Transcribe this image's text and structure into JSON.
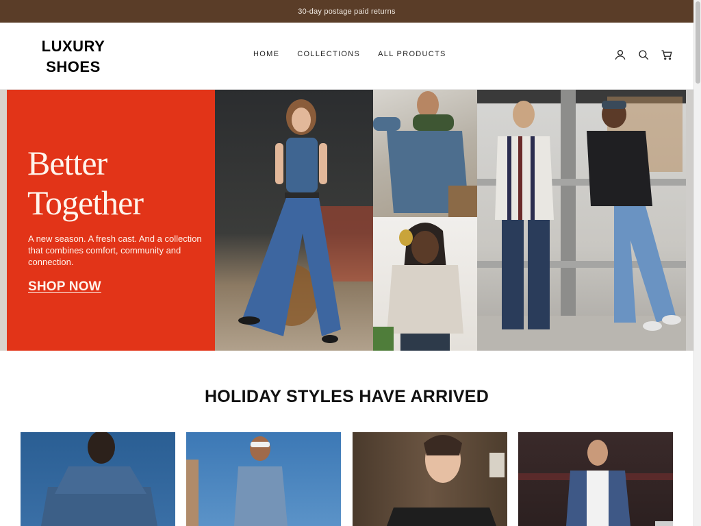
{
  "announcement": {
    "text": "30-day postage paid returns"
  },
  "header": {
    "logo_line1": "LUXURY",
    "logo_line2": "SHOES",
    "nav": [
      {
        "label": "HOME"
      },
      {
        "label": "COLLECTIONS"
      },
      {
        "label": "ALL PRODUCTS"
      }
    ],
    "icons": [
      "account-icon",
      "search-icon",
      "cart-icon"
    ]
  },
  "hero": {
    "title_line1": "Better",
    "title_line2": "Together",
    "text": "A new season. A fresh cast. And a collection that combines comfort, community and connection.",
    "cta": "SHOP NOW",
    "promo_color": "#e23418"
  },
  "featured": {
    "title": "HOLIDAY STYLES HAVE ARRIVED",
    "cards": [
      {
        "name": "product-card-1"
      },
      {
        "name": "product-card-2"
      },
      {
        "name": "product-card-3"
      },
      {
        "name": "product-card-4"
      }
    ]
  },
  "colors": {
    "announcement_bg": "#5a3d28",
    "accent": "#e23418"
  }
}
